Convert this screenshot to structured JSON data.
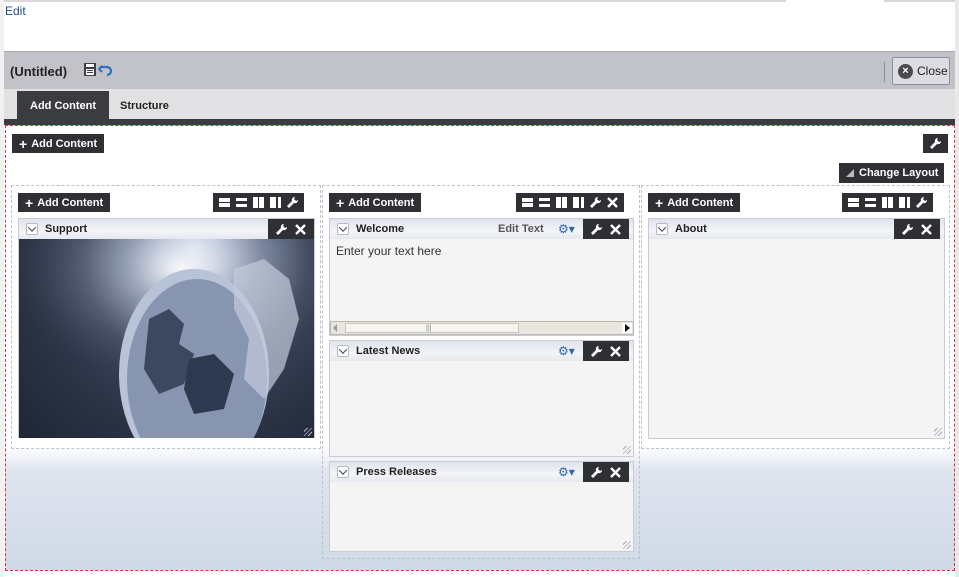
{
  "top": {
    "edit_link": "Edit"
  },
  "titlebar": {
    "title": "(Untitled)",
    "close_label": "Close"
  },
  "tabs": [
    {
      "label": "Add Content"
    },
    {
      "label": "Structure"
    }
  ],
  "canvas": {
    "add_content_label": "Add Content",
    "change_layout_label": "Change Layout"
  },
  "columns": [
    {
      "add_content_label": "Add Content",
      "portlets": [
        {
          "title": "Support"
        }
      ]
    },
    {
      "add_content_label": "Add Content",
      "portlets": [
        {
          "title": "Welcome",
          "edit_text_label": "Edit Text",
          "body": "Enter your text here"
        },
        {
          "title": "Latest News"
        },
        {
          "title": "Press Releases"
        }
      ]
    },
    {
      "add_content_label": "Add Content",
      "portlets": [
        {
          "title": "About"
        }
      ]
    }
  ],
  "icons": {
    "save": "save-icon",
    "undo": "undo-icon",
    "close": "close-circle-icon",
    "wrench": "wrench-icon",
    "x": "close-x-icon",
    "gear": "gear-dropdown-icon",
    "layouts": [
      "layout-one-column-icon",
      "layout-two-row-icon",
      "layout-two-column-icon",
      "layout-three-column-icon"
    ]
  },
  "colors": {
    "toolbar_dark": "#2f3034",
    "titlebar": "#c2c3c9",
    "link_blue": "#1a4e9c",
    "canvas_border": "#dd3333"
  }
}
